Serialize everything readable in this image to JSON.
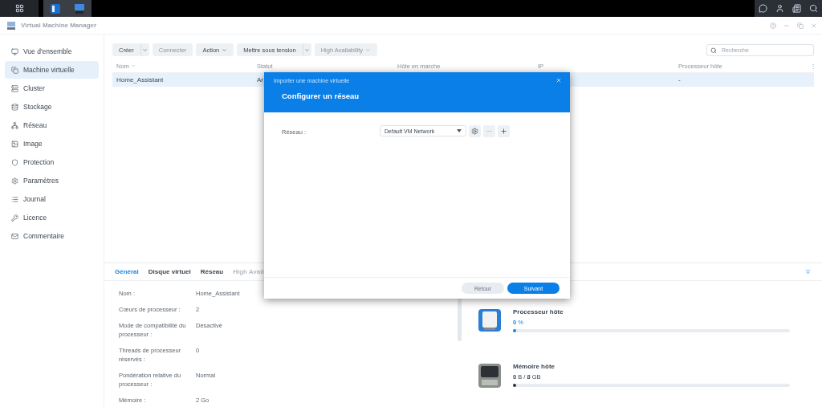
{
  "window": {
    "title": "Virtual Machine Manager"
  },
  "sidebar": {
    "items": [
      {
        "label": "Vue d'ensemble",
        "selected": false
      },
      {
        "label": "Machine virtuelle",
        "selected": true
      },
      {
        "label": "Cluster",
        "selected": false
      },
      {
        "label": "Stockage",
        "selected": false
      },
      {
        "label": "Réseau",
        "selected": false
      },
      {
        "label": "Image",
        "selected": false
      },
      {
        "label": "Protection",
        "selected": false
      },
      {
        "label": "Paramètres",
        "selected": false
      },
      {
        "label": "Journal",
        "selected": false
      },
      {
        "label": "Licence",
        "selected": false
      },
      {
        "label": "Commentaire",
        "selected": false
      }
    ]
  },
  "toolbar": {
    "buttons": [
      {
        "label": "Créer",
        "kind": "split",
        "disabled": false
      },
      {
        "label": "Connecter",
        "kind": "plain",
        "disabled": true
      },
      {
        "label": "Action",
        "kind": "menu",
        "disabled": false
      },
      {
        "label": "Mettre sous tension",
        "kind": "split",
        "disabled": false
      },
      {
        "label": "High Availability",
        "kind": "menu",
        "disabled": true
      }
    ]
  },
  "search": {
    "placeholder": "Recherche"
  },
  "table": {
    "columns": [
      "Nom",
      "Statut",
      "Hôte en marche",
      "IP",
      "Processeur hôte"
    ],
    "menu_glyph": "⋮",
    "rows": [
      {
        "name": "Home_Assistant",
        "status": "Ar",
        "host_cpu": "-",
        "selected": true
      }
    ]
  },
  "details": {
    "tabs": [
      {
        "label": "Général",
        "selected": true,
        "disabled": false
      },
      {
        "label": "Disque virtuel",
        "selected": false,
        "disabled": false
      },
      {
        "label": "Réseau",
        "selected": false,
        "disabled": false
      },
      {
        "label": "High Avail",
        "selected": false,
        "disabled": true
      }
    ],
    "fields": [
      {
        "label": "Nom :",
        "value": "Home_Assistant"
      },
      {
        "label": "Cœurs de processeur :",
        "value": "2"
      },
      {
        "label": "Mode de compatibilité du processeur :",
        "value": "Désactivé"
      },
      {
        "label": "Threads de processeur réservés :",
        "value": "0"
      },
      {
        "label": "Pondération relative du processeur :",
        "value": "Normal"
      },
      {
        "label": "Mémoire :",
        "value": "2 Go"
      }
    ]
  },
  "meters": [
    {
      "kind": "cpu",
      "title": "Processeur hôte",
      "reading": "**0** %",
      "level": 0.005
    },
    {
      "kind": "memory",
      "title": "Mémoire hôte",
      "reading": "**0** B / **8** GB",
      "level": 0.005
    }
  ],
  "dialog": {
    "title": "Importer une machine virtuelle",
    "heading": "Configurer un réseau",
    "field_label": "Réseau :",
    "field_value": "Default VM Network",
    "actions": [
      {
        "kind": "settings",
        "disabled": false
      },
      {
        "kind": "remove",
        "disabled": true
      },
      {
        "kind": "add",
        "disabled": false
      }
    ],
    "buttons": [
      {
        "label": "Retour",
        "kind": "secondary"
      },
      {
        "label": "Suivant",
        "kind": "primary"
      }
    ]
  }
}
